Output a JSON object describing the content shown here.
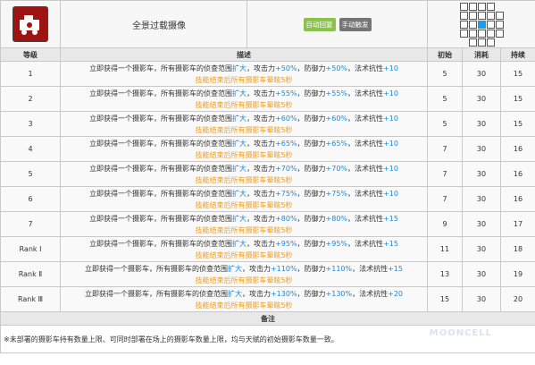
{
  "skill": {
    "name": "全景过载摄像",
    "tag_auto": "自动回复",
    "tag_manual": "手动触发",
    "range": [
      [
        1,
        1,
        1,
        1,
        0
      ],
      [
        1,
        1,
        1,
        1,
        1
      ],
      [
        1,
        1,
        2,
        1,
        1
      ],
      [
        1,
        1,
        1,
        1,
        1
      ],
      [
        0,
        1,
        1,
        1,
        0
      ]
    ]
  },
  "columns": {
    "level": "等级",
    "desc": "描述",
    "initial": "初始",
    "cost": "消耗",
    "duration": "持续"
  },
  "rows": [
    {
      "level": "1",
      "d1": "立即获得一个摄影车，所有摄影车的侦查范围",
      "d_blue1": "扩大",
      "d2": "，攻击力",
      "v1": "+50%",
      "d3": "，防御力",
      "v2": "+50%",
      "d4": "，法术抗性",
      "v3": "+10",
      "line2": "技能结束后所有摄影车晕眩5秒",
      "initial": "5",
      "cost": "30",
      "duration": "15"
    },
    {
      "level": "2",
      "d1": "立即获得一个摄影车，所有摄影车的侦查范围",
      "d_blue1": "扩大",
      "d2": "，攻击力",
      "v1": "+55%",
      "d3": "，防御力",
      "v2": "+55%",
      "d4": "，法术抗性",
      "v3": "+10",
      "line2": "技能结束后所有摄影车晕眩5秒",
      "initial": "5",
      "cost": "30",
      "duration": "15"
    },
    {
      "level": "3",
      "d1": "立即获得一个摄影车，所有摄影车的侦查范围",
      "d_blue1": "扩大",
      "d2": "，攻击力",
      "v1": "+60%",
      "d3": "，防御力",
      "v2": "+60%",
      "d4": "，法术抗性",
      "v3": "+10",
      "line2": "技能结束后所有摄影车晕眩5秒",
      "initial": "5",
      "cost": "30",
      "duration": "15"
    },
    {
      "level": "4",
      "d1": "立即获得一个摄影车，所有摄影车的侦查范围",
      "d_blue1": "扩大",
      "d2": "，攻击力",
      "v1": "+65%",
      "d3": "，防御力",
      "v2": "+65%",
      "d4": "，法术抗性",
      "v3": "+10",
      "line2": "技能结束后所有摄影车晕眩5秒",
      "initial": "7",
      "cost": "30",
      "duration": "16"
    },
    {
      "level": "5",
      "d1": "立即获得一个摄影车，所有摄影车的侦查范围",
      "d_blue1": "扩大",
      "d2": "，攻击力",
      "v1": "+70%",
      "d3": "，防御力",
      "v2": "+70%",
      "d4": "，法术抗性",
      "v3": "+10",
      "line2": "技能结束后所有摄影车晕眩5秒",
      "initial": "7",
      "cost": "30",
      "duration": "16"
    },
    {
      "level": "6",
      "d1": "立即获得一个摄影车，所有摄影车的侦查范围",
      "d_blue1": "扩大",
      "d2": "，攻击力",
      "v1": "+75%",
      "d3": "，防御力",
      "v2": "+75%",
      "d4": "，法术抗性",
      "v3": "+10",
      "line2": "技能结束后所有摄影车晕眩5秒",
      "initial": "7",
      "cost": "30",
      "duration": "16"
    },
    {
      "level": "7",
      "d1": "立即获得一个摄影车，所有摄影车的侦查范围",
      "d_blue1": "扩大",
      "d2": "，攻击力",
      "v1": "+80%",
      "d3": "，防御力",
      "v2": "+80%",
      "d4": "，法术抗性",
      "v3": "+15",
      "line2": "技能结束后所有摄影车晕眩5秒",
      "initial": "9",
      "cost": "30",
      "duration": "17"
    },
    {
      "level": "Rank Ⅰ",
      "d1": "立即获得一个摄影车，所有摄影车的侦查范围",
      "d_blue1": "扩大",
      "d2": "，攻击力",
      "v1": "+95%",
      "d3": "，防御力",
      "v2": "+95%",
      "d4": "，法术抗性",
      "v3": "+15",
      "line2": "技能结束后所有摄影车晕眩5秒",
      "initial": "11",
      "cost": "30",
      "duration": "18"
    },
    {
      "level": "Rank Ⅱ",
      "d1": "立即获得一个摄影车，所有摄影车的侦查范围",
      "d_blue1": "扩大",
      "d2": "，攻击力",
      "v1": "+110%",
      "d3": "，防御力",
      "v2": "+110%",
      "d4": "，法术抗性",
      "v3": "+15",
      "line2": "技能结束后所有摄影车晕眩5秒",
      "initial": "13",
      "cost": "30",
      "duration": "19"
    },
    {
      "level": "Rank Ⅲ",
      "d1": "立即获得一个摄影车，所有摄影车的侦查范围",
      "d_blue1": "扩大",
      "d2": "，攻击力",
      "v1": "+130%",
      "d3": "，防御力",
      "v2": "+130%",
      "d4": "，法术抗性",
      "v3": "+20",
      "line2": "技能结束后所有摄影车晕眩5秒",
      "initial": "15",
      "cost": "30",
      "duration": "20"
    }
  ],
  "notes": {
    "header": "备注",
    "text": "※未部署的摄影车持有数量上限、可同时部署在场上的摄影车数量上限，均与天赋的初始摄影车数量一致。"
  },
  "watermark": "MOONCELL",
  "colors": {
    "blue": "#1e88d8",
    "orange": "#f39c12",
    "auto": "#8bc34a",
    "manual": "#757575",
    "range_center": "#1e9be8",
    "icon_bg": "#a01313"
  }
}
